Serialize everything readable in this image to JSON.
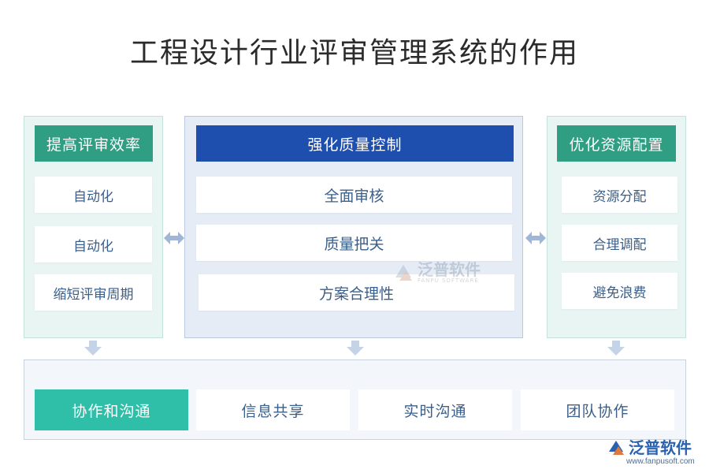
{
  "title": "工程设计行业评审管理系统的作用",
  "left": {
    "header": "提高评审效率",
    "items": [
      "自动化",
      "自动化",
      "缩短评审周期"
    ]
  },
  "middle": {
    "header": "强化质量控制",
    "items": [
      "全面审核",
      "质量把关",
      "方案合理性"
    ]
  },
  "right": {
    "header": "优化资源配置",
    "items": [
      "资源分配",
      "合理调配",
      "避免浪费"
    ]
  },
  "bottom": {
    "items": [
      "协作和沟通",
      "信息共享",
      "实时沟通",
      "团队协作"
    ]
  },
  "watermark": {
    "name": "泛普软件",
    "sub": "FANPU SOFTWARE"
  },
  "brand": {
    "name": "泛普软件",
    "url": "www.fanpusoft.com"
  },
  "colors": {
    "teal_header": "#2f9e83",
    "blue_header": "#1f4fae",
    "active_card": "#2fbfa8",
    "arrow": "#9fb6d6"
  }
}
